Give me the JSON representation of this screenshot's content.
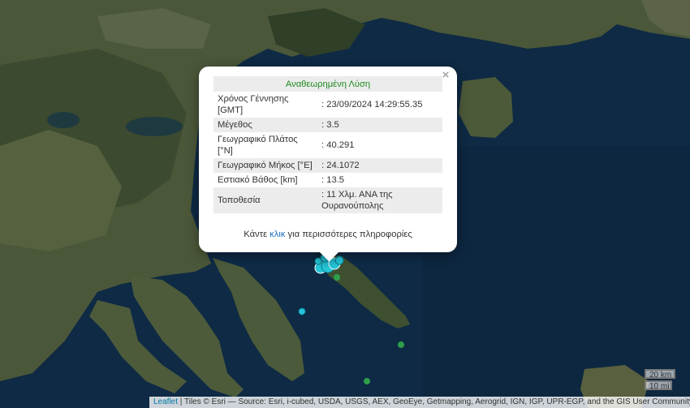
{
  "popup": {
    "title": "Αναθεωρημένη Λύση",
    "close": "×",
    "rows": [
      {
        "label": "Χρόνος Γέννησης [GMT]",
        "value": ": 23/09/2024 14:29:55.35"
      },
      {
        "label": "Μέγεθος",
        "value": ": 3.5"
      },
      {
        "label": "Γεωγραφικό Πλάτος [°N]",
        "value": ": 40.291"
      },
      {
        "label": "Γεωγραφικό Μήκος [°E]",
        "value": ": 24.1072"
      },
      {
        "label": "Εστιακό Βάθος [km]",
        "value": ": 13.5"
      },
      {
        "label": "Τοποθεσία",
        "value": ": 11 Χλμ. ΑΝΑ της Ουρανούπολης"
      }
    ],
    "footer_before": "Κάντε ",
    "footer_link": "κλικ",
    "footer_after": " για περισσότερες πληροφορίες"
  },
  "scale": {
    "km": "20 km",
    "mi": "10 mi"
  },
  "attribution": {
    "leaflet": "Leaflet",
    "text": " | Tiles © Esri — Source: Esri, i-cubed, USDA, USGS, AEX, GeoEye, Getmapping, Aerogrid, IGN, IGP, UPR-EGP, and the GIS User Community"
  },
  "colors": {
    "sea": "#0e2a44",
    "land": "#49563a",
    "marker_recent": "#26c6da",
    "marker_old": "#2e9e4a",
    "title_green": "#1d8a1d",
    "link": "#1a6ec5"
  },
  "map_icons": [
    "earthquake-marker-cyan",
    "earthquake-marker-green"
  ]
}
